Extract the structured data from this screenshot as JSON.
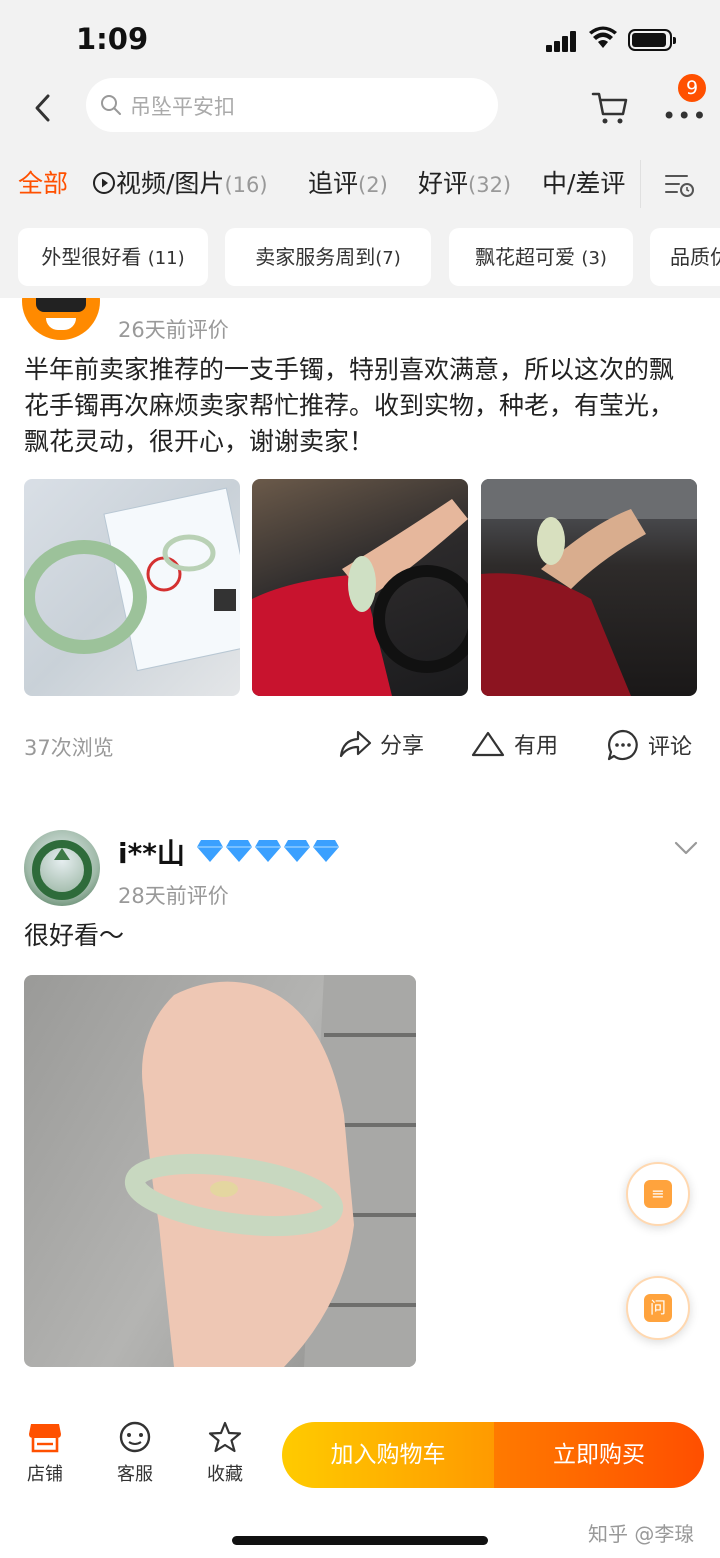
{
  "status_bar": {
    "time": "1:09"
  },
  "header": {
    "search_placeholder": "吊坠平安扣",
    "more_badge": "9"
  },
  "tabs": [
    {
      "label": "全部",
      "count": ""
    },
    {
      "label": "视频/图片",
      "count": "(16)"
    },
    {
      "label": "追评",
      "count": "(2)"
    },
    {
      "label": "好评",
      "count": "(32)"
    },
    {
      "label": "中/差评",
      "count": ""
    }
  ],
  "chips": [
    {
      "label": "外型很好看",
      "count": "(11)"
    },
    {
      "label": "卖家服务周到",
      "count": "(7)"
    },
    {
      "label": "飘花超可爱",
      "count": "(3)"
    },
    {
      "label": "品质优",
      "count": ""
    }
  ],
  "reviews": [
    {
      "date": "26天前评价",
      "text": "半年前卖家推荐的一支手镯，特别喜欢满意，所以这次的飘花手镯再次麻烦卖家帮忙推荐。收到实物，种老，有莹光，飘花灵动，很开心，谢谢卖家！",
      "views": "37次浏览",
      "share_label": "分享",
      "useful_label": "有用",
      "comment_label": "评论"
    },
    {
      "username": "i**山",
      "date": "28天前评价",
      "text": "很好看～"
    }
  ],
  "bottom_bar": {
    "shop_label": "店铺",
    "service_label": "客服",
    "favorite_label": "收藏",
    "add_to_cart": "加入购物车",
    "buy_now": "立即购买",
    "watermark": "知乎 @李瑔"
  },
  "floating": {
    "ask_label": "问"
  },
  "colors": {
    "accent": "#ff5000",
    "diamond": "#3aa0ff"
  }
}
